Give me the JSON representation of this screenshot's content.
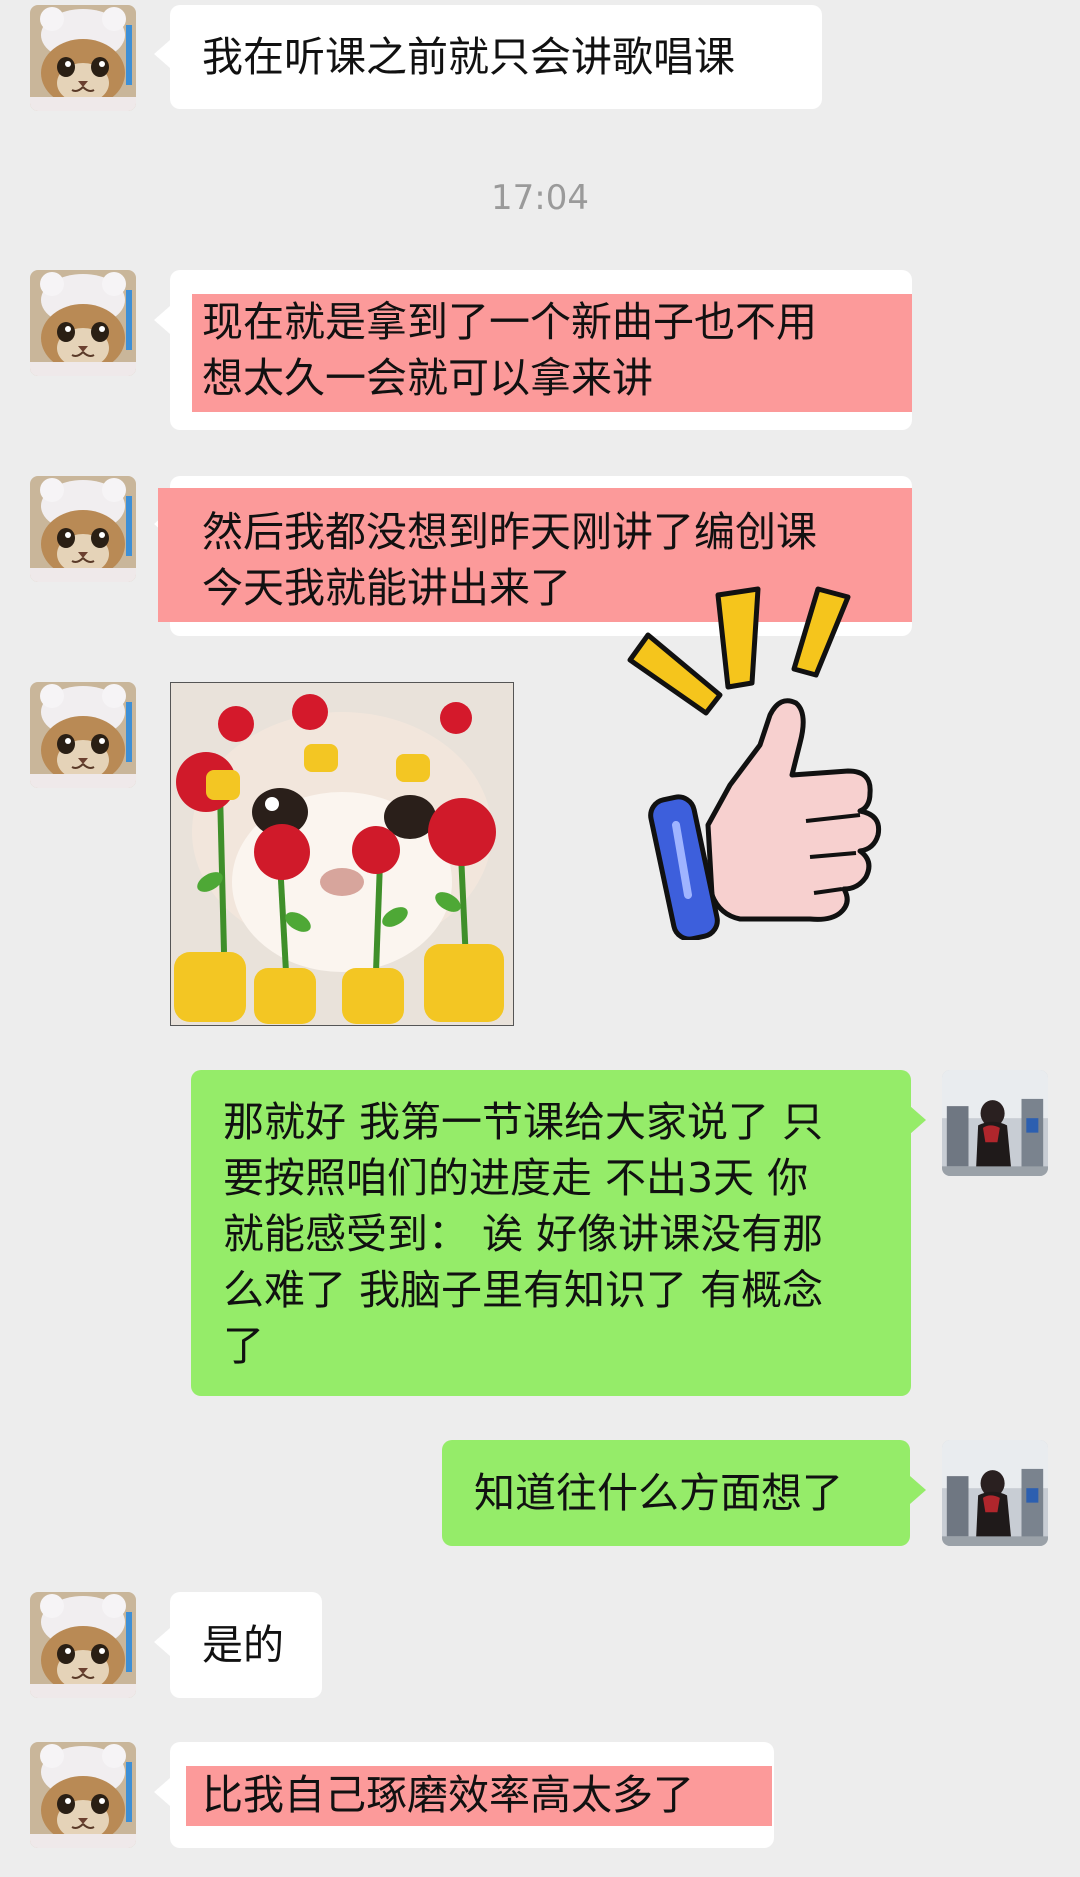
{
  "timestamp": "17:04",
  "messages": {
    "m1": "我在听课之前就只会讲歌唱课",
    "m2": "现在就是拿到了一个新曲子也不用\n想太久一会就可以拿来讲",
    "m3": "然后我都没想到昨天刚讲了编创课\n今天我就能讲出来了",
    "m5": "那就好 我第一节课给大家说了 只\n要按照咱们的进度走 不出3天 你\n就能感受到： 诶 好像讲课没有那\n么难了 我脑子里有知识了 有概念\n了",
    "m6": "知道往什么方面想了",
    "m7": "是的",
    "m8": "比我自己琢磨效率高太多了"
  },
  "colors": {
    "background": "#ededed",
    "bubble_left": "#ffffff",
    "bubble_right": "#95ec69",
    "highlight": "#fc9a9a"
  },
  "icons": {
    "cat_avatar": "cat-avatar-icon",
    "user_avatar": "user-avatar-icon",
    "thumbs_up": "thumbs-up-sticker-icon",
    "rose_sticker": "cat-with-roses-sticker"
  }
}
